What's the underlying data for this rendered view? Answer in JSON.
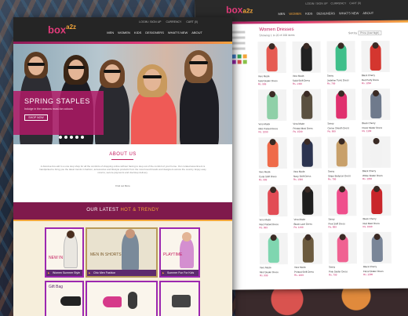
{
  "catalog": {
    "logo": {
      "main": "box",
      "suffix": "a2z"
    },
    "util_links": [
      "LOGIN / SIGN UP",
      "CURRENCY",
      "CART (0)"
    ],
    "nav": [
      "MEN",
      "WOMEN",
      "KIDS",
      "DESIGNERS",
      "WHAT'S NEW",
      "ABOUT"
    ],
    "title": "Women Dresses",
    "subtitle": "Showing 1 to 20 of 200 items",
    "sort_label": "Sort by",
    "sort_value": "Price (low-high)",
    "filter_colors": [
      "#e23b7a",
      "#3f7fcf",
      "#3aa657",
      "#f2a53a",
      "#222222",
      "#9c27b0",
      "#d9534f",
      "#8bc34a"
    ],
    "products": [
      {
        "name": "Vero Moda",
        "desc": "Solid Skater Dress",
        "price": "Rs. 999",
        "color": "#e65b52"
      },
      {
        "name": "Vera Moda",
        "desc": "Solid Shift Dress",
        "price": "Rs. 1499",
        "color": "#222222"
      },
      {
        "name": "Sassy",
        "desc": "Jadeline Tunic Dress",
        "price": "Rs. 799",
        "color": "#3fbf8a"
      },
      {
        "name": "Black Cherry",
        "desc": "Red Party Dress",
        "price": "Rs. 1299",
        "color": "#d4362f"
      },
      {
        "name": "Vero Moda",
        "desc": "Mint Printed Dress",
        "price": "Rs. 1099",
        "color": "#8fd0a8"
      },
      {
        "name": "Vera Moda",
        "desc": "Printed Maxi Dress",
        "price": "Rs. 1599",
        "color": "#5a5040"
      },
      {
        "name": "Sassy",
        "desc": "Cerise Sheath Dress",
        "price": "Rs. 899",
        "color": "#e0306e"
      },
      {
        "name": "Black Cherry",
        "desc": "Floral Skater Dress",
        "price": "Rs. 1199",
        "color": "#6f7a8c"
      },
      {
        "name": "Vero Moda",
        "desc": "Coral Shift Dress",
        "price": "Rs. 999",
        "color": "#ef6b4a"
      },
      {
        "name": "Vera Moda",
        "desc": "Navy Shift Dress",
        "price": "Rs. 1399",
        "color": "#2c3450"
      },
      {
        "name": "Sassy",
        "desc": "Stripe Bodycon Dress",
        "price": "Rs. 799",
        "color": "#c8a06a"
      },
      {
        "name": "Black Cherry",
        "desc": "White Skater Dress",
        "price": "Rs. 1299",
        "color": "#f2f2f2"
      },
      {
        "name": "Vero Moda",
        "desc": "Red Printed Dress",
        "price": "Rs. 999",
        "color": "#e24c55"
      },
      {
        "name": "Vera Moda",
        "desc": "Black Lace Dress",
        "price": "Rs. 1499",
        "color": "#1e1e1e"
      },
      {
        "name": "Sassy",
        "desc": "Pink Shift Dress",
        "price": "Rs. 899",
        "color": "#ef4f8c"
      },
      {
        "name": "Black Cherry",
        "desc": "Red Maxi Dress",
        "price": "Rs. 1599",
        "color": "#c9262b"
      },
      {
        "name": "Vero Moda",
        "desc": "Mint Skater Dress",
        "price": "Rs. 999",
        "color": "#7fd6b0"
      },
      {
        "name": "Vera Moda",
        "desc": "Printed Shift Dress",
        "price": "Rs. 1199",
        "color": "#6b5a3e"
      },
      {
        "name": "Sassy",
        "desc": "Pink Skater Dress",
        "price": "Rs. 799",
        "color": "#f06292"
      },
      {
        "name": "Black Cherry",
        "desc": "Floral Skater Dress",
        "price": "Rs. 1299",
        "color": "#7a8698"
      }
    ]
  },
  "home": {
    "logo": {
      "main": "box",
      "suffix": "a2z"
    },
    "util_links": [
      "LOGIN / SIGN UP",
      "CURRENCY",
      "CART (0)"
    ],
    "nav": [
      "MEN",
      "WOMEN",
      "KIDS",
      "DESIGNERS",
      "WHAT'S NEW",
      "ABOUT"
    ],
    "hero": {
      "title": "SPRING STAPLES",
      "subtitle": "Indulge in the seasons must-fun colours",
      "button": "SHOP NOW"
    },
    "about": {
      "title": "ABOUT US",
      "text": "A-brand-a-box-a2z is a one stop shop for all the comforts of shopping online without having to step out of the comfort of your home. Our curated assortment is handpicked to bring you the latest trends in fashion, accessories and lifestyle products from the most loved brands and designers across the country. Enjoy easy returns, secure payments and doorstep delivery.",
      "more": "Find out More"
    },
    "trendy": {
      "prefix": "OUR LATEST ",
      "highlight": "HOT & TRENDY"
    },
    "tiles": [
      {
        "label": "NEW IN",
        "caption": "Women Summer Style"
      },
      {
        "label": "MEN IN SHORTS",
        "caption": "Chic Men Fashion"
      },
      {
        "label": "PLAYTIME",
        "caption": "Summer Fun For Kids"
      },
      {
        "label": "Gift Bag",
        "caption": ""
      },
      {
        "label": "",
        "caption": ""
      },
      {
        "label": "",
        "caption": ""
      }
    ]
  },
  "colors": {
    "accent": "#e23b7a",
    "brand_dark": "#7f1a4c",
    "gold": "#f2a53a",
    "purple": "#9c27b0"
  }
}
